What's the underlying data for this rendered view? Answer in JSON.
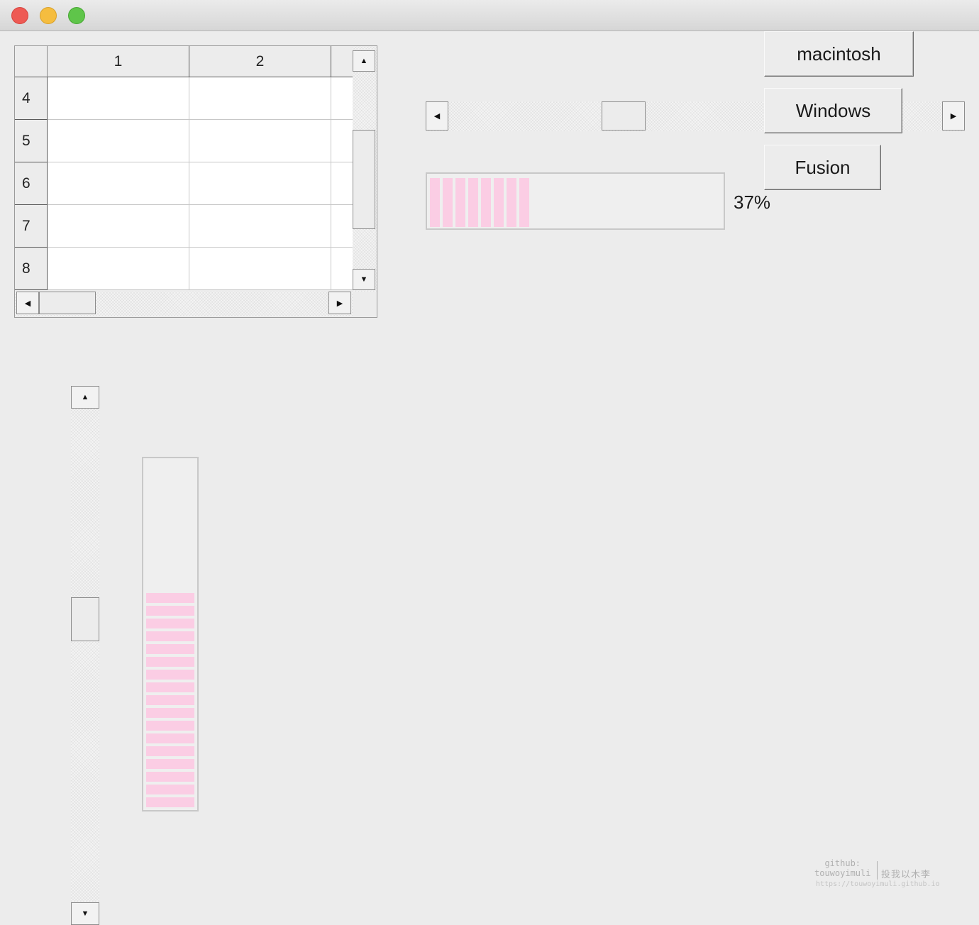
{
  "window": {
    "traffic_lights": {
      "close_color": "#ee5a54",
      "minimize_color": "#f5bd3f",
      "maximize_color": "#5fc54a"
    }
  },
  "table": {
    "column_headers": [
      "1",
      "2"
    ],
    "row_headers": [
      "4",
      "5",
      "6",
      "7",
      "8"
    ],
    "cells": [
      [
        "",
        ""
      ],
      [
        "",
        ""
      ],
      [
        "",
        ""
      ],
      [
        "",
        ""
      ],
      [
        "",
        ""
      ]
    ]
  },
  "style_buttons": {
    "macintosh": "macintosh",
    "windows": "Windows",
    "fusion": "Fusion"
  },
  "horizontal_progress": {
    "value_percent": 37,
    "label": "37%",
    "chunk_color": "#fbcde4"
  },
  "vertical_progress": {
    "chunk_color": "#fbcde4"
  },
  "watermark": {
    "line1": "github:",
    "line2": "touwoyimuli",
    "motto": "投我以木李",
    "url": "https://touwoyimuli.github.io"
  }
}
